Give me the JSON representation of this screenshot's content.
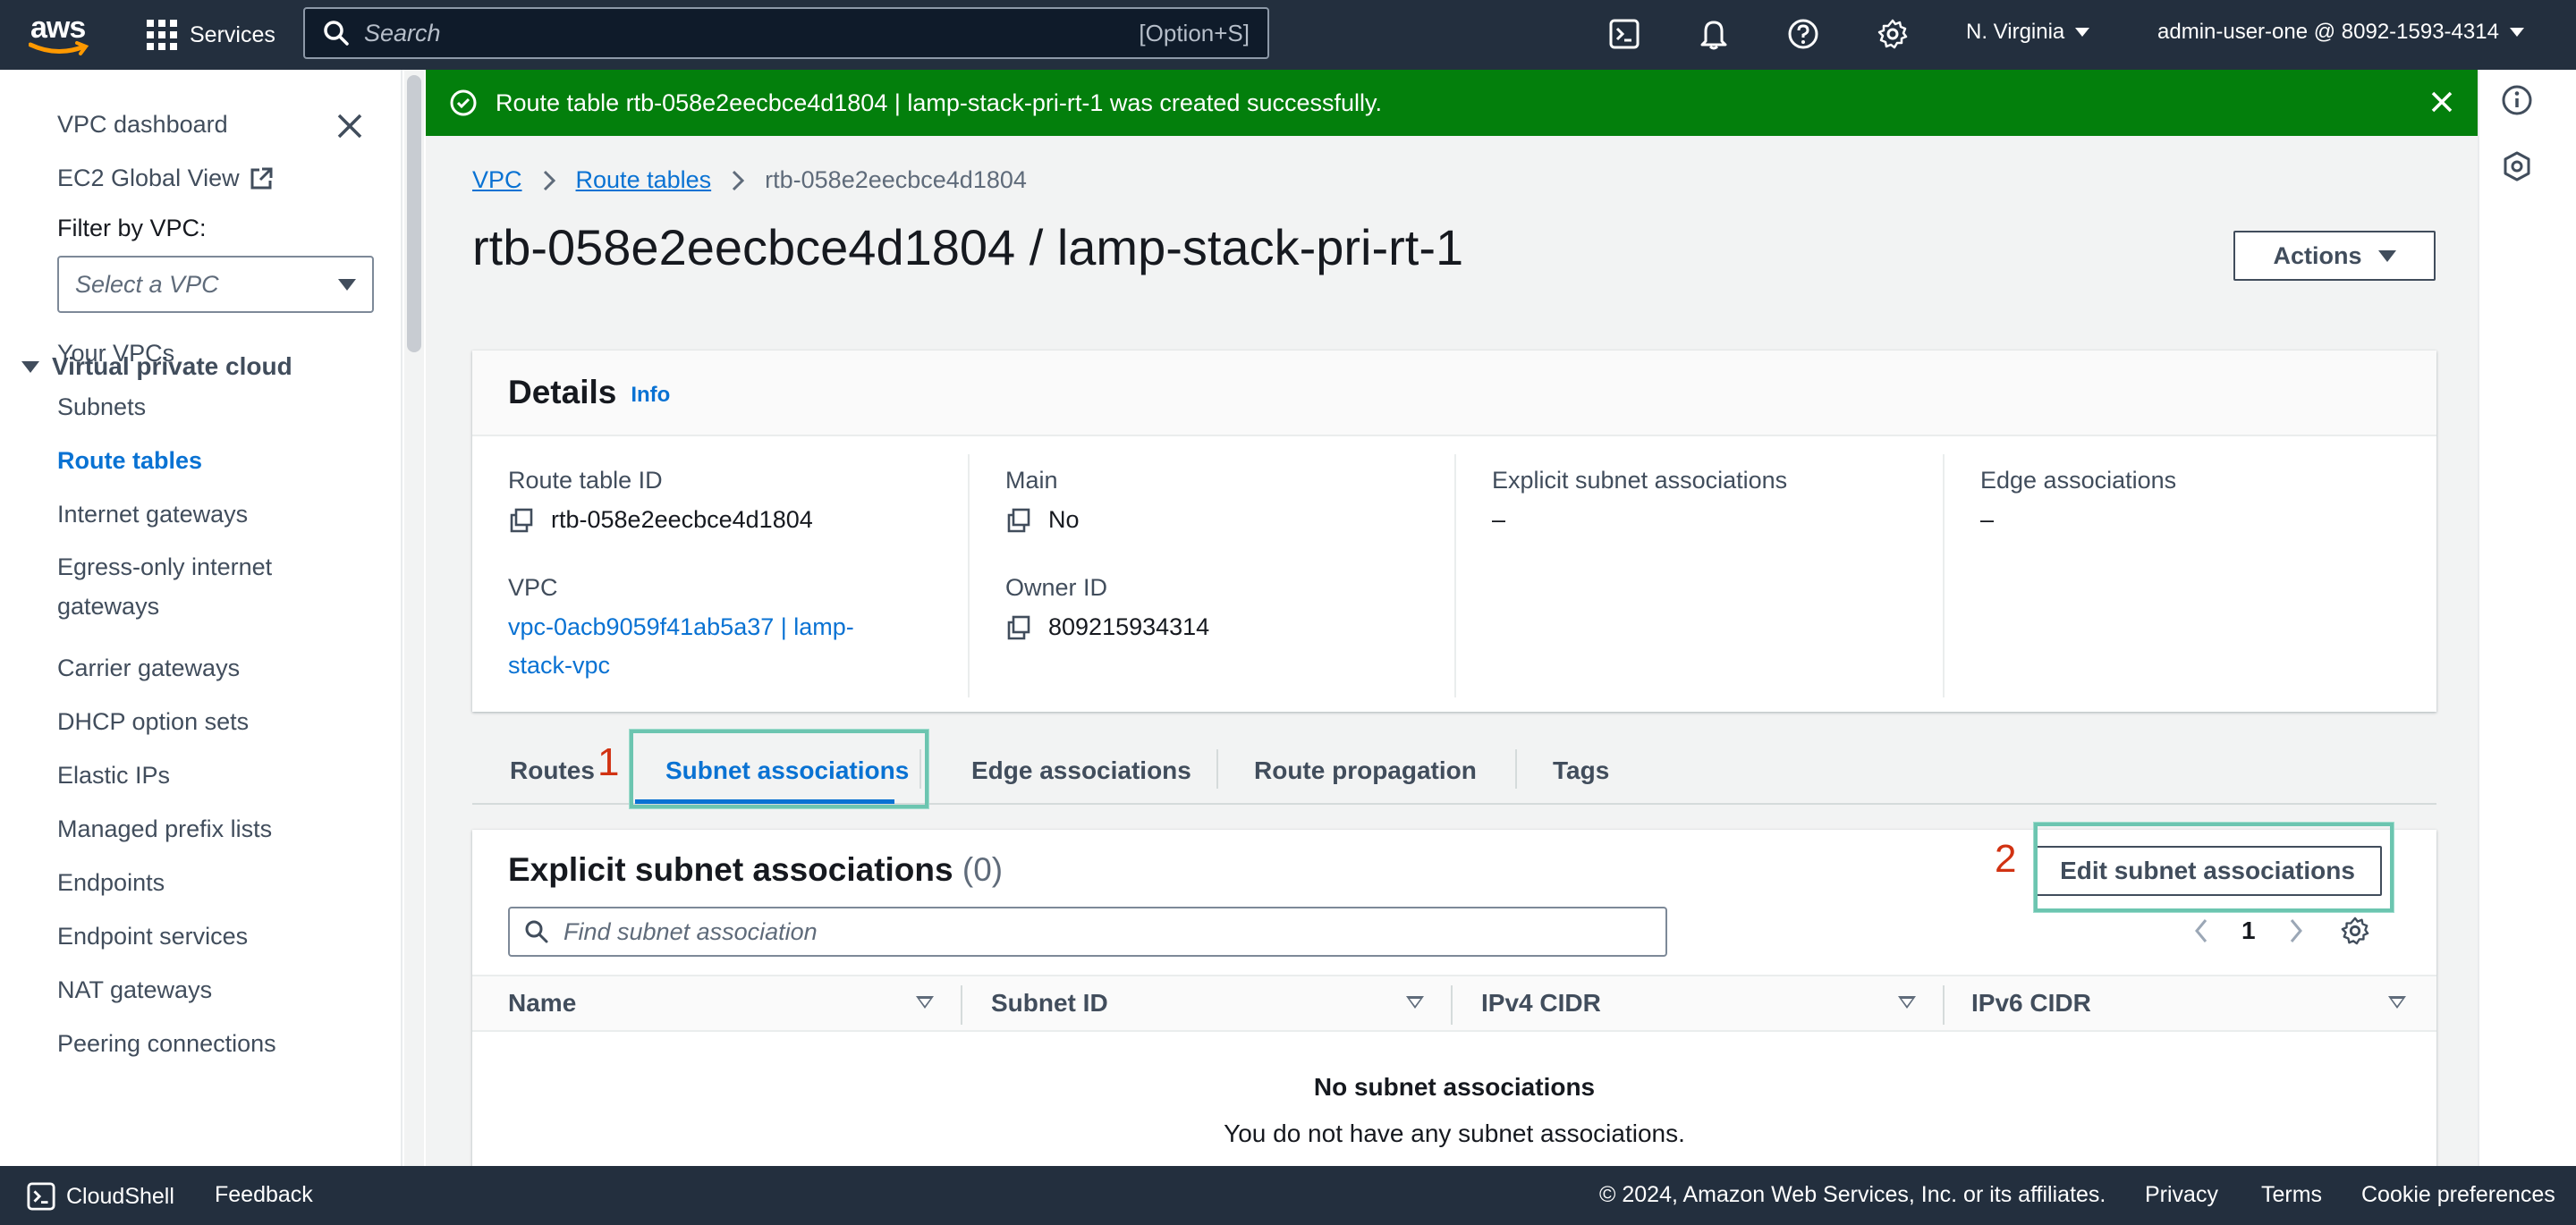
{
  "topnav": {
    "logo_text": "aws",
    "services_label": "Services",
    "search_placeholder": "Search",
    "search_shortcut": "[Option+S]",
    "region": "N. Virginia",
    "account": "admin-user-one @ 8092-1593-4314"
  },
  "sidebar": {
    "top_items": [
      {
        "label": "VPC dashboard"
      },
      {
        "label": "EC2 Global View"
      }
    ],
    "filter_label": "Filter by VPC:",
    "filter_placeholder": "Select a VPC",
    "section_title": "Virtual private cloud",
    "items": [
      {
        "label": "Your VPCs"
      },
      {
        "label": "Subnets"
      },
      {
        "label": "Route tables",
        "active": true
      },
      {
        "label": "Internet gateways"
      },
      {
        "label": "Egress-only internet gateways"
      },
      {
        "label": "Carrier gateways"
      },
      {
        "label": "DHCP option sets"
      },
      {
        "label": "Elastic IPs"
      },
      {
        "label": "Managed prefix lists"
      },
      {
        "label": "Endpoints"
      },
      {
        "label": "Endpoint services"
      },
      {
        "label": "NAT gateways"
      },
      {
        "label": "Peering connections"
      }
    ]
  },
  "flash": {
    "message": "Route table rtb-058e2eecbce4d1804 | lamp-stack-pri-rt-1 was created successfully.",
    "color": "#037f0c"
  },
  "breadcrumb": {
    "items": [
      "VPC",
      "Route tables"
    ],
    "current": "rtb-058e2eecbce4d1804"
  },
  "page": {
    "title": "rtb-058e2eecbce4d1804 / lamp-stack-pri-rt-1",
    "actions_label": "Actions"
  },
  "details": {
    "title": "Details",
    "info_label": "Info",
    "route_table_id_label": "Route table ID",
    "route_table_id": "rtb-058e2eecbce4d1804",
    "main_label": "Main",
    "main_value": "No",
    "explicit_label": "Explicit subnet associations",
    "explicit_value": "–",
    "edge_label": "Edge associations",
    "edge_value": "–",
    "vpc_label": "VPC",
    "vpc_value_line1": "vpc-0acb9059f41ab5a37 | lamp-",
    "vpc_value_line2": "stack-vpc",
    "owner_label": "Owner ID",
    "owner_value": "809215934314"
  },
  "tabs": [
    {
      "label": "Routes"
    },
    {
      "label": "Subnet associations",
      "active": true
    },
    {
      "label": "Edge associations"
    },
    {
      "label": "Route propagation"
    },
    {
      "label": "Tags"
    }
  ],
  "annotations": {
    "step1": "1",
    "step2": "2",
    "highlight_color": "#6cc5b0",
    "number_color": "#d13212"
  },
  "associations": {
    "title": "Explicit subnet associations",
    "count": "(0)",
    "edit_label": "Edit subnet associations",
    "filter_placeholder": "Find subnet association",
    "page_number": "1",
    "columns": [
      "Name",
      "Subnet ID",
      "IPv4 CIDR",
      "IPv6 CIDR"
    ],
    "empty_title": "No subnet associations",
    "empty_message": "You do not have any subnet associations."
  },
  "footer": {
    "cloudshell": "CloudShell",
    "feedback": "Feedback",
    "copyright": "© 2024, Amazon Web Services, Inc. or its affiliates.",
    "privacy": "Privacy",
    "terms": "Terms",
    "cookies": "Cookie preferences"
  },
  "colors": {
    "nav_bg": "#232f3e",
    "link": "#0972d3",
    "success": "#037f0c"
  }
}
